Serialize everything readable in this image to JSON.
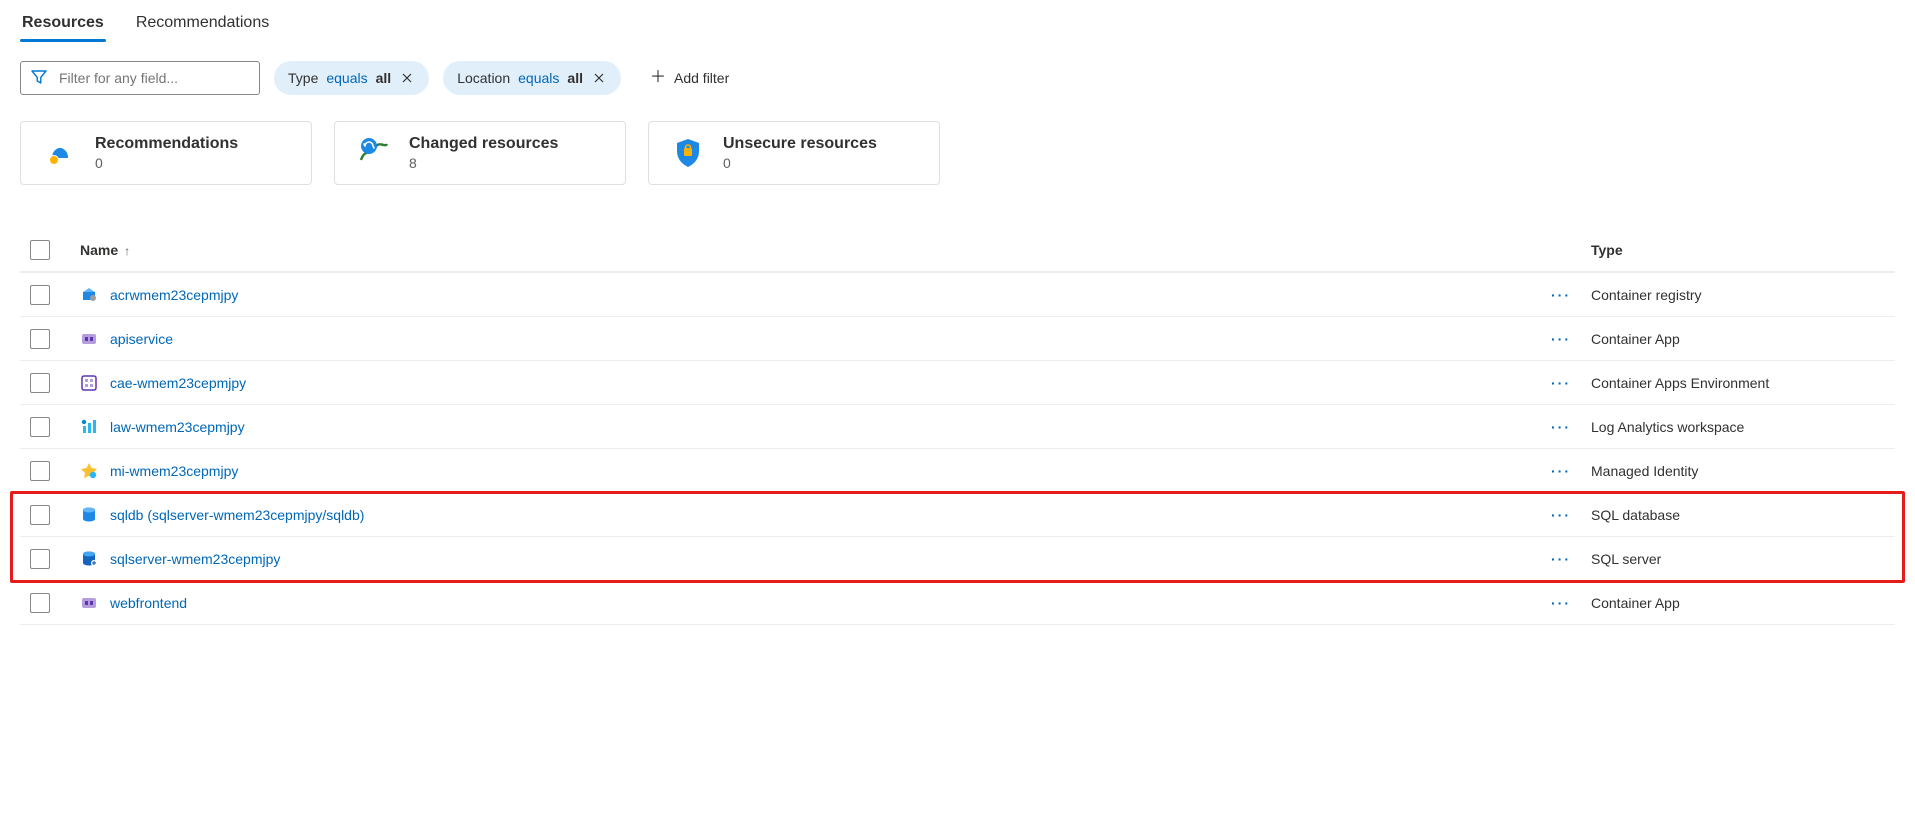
{
  "tabs": {
    "resources": "Resources",
    "recommendations": "Recommendations"
  },
  "filters": {
    "input_placeholder": "Filter for any field...",
    "chip1_field": "Type",
    "chip1_op": "equals",
    "chip1_val": "all",
    "chip2_field": "Location",
    "chip2_op": "equals",
    "chip2_val": "all",
    "add_label": "Add filter"
  },
  "cards": {
    "recs_title": "Recommendations",
    "recs_count": "0",
    "changed_title": "Changed resources",
    "changed_count": "8",
    "unsecure_title": "Unsecure resources",
    "unsecure_count": "0"
  },
  "table": {
    "col_name": "Name",
    "sort_arrow": "↑",
    "col_type": "Type",
    "rows": [
      {
        "name": "acrwmem23cepmjpy",
        "type": "Container registry",
        "icon": "registry"
      },
      {
        "name": "apiservice",
        "type": "Container App",
        "icon": "containerapp"
      },
      {
        "name": "cae-wmem23cepmjpy",
        "type": "Container Apps Environment",
        "icon": "cae"
      },
      {
        "name": "law-wmem23cepmjpy",
        "type": "Log Analytics workspace",
        "icon": "law"
      },
      {
        "name": "mi-wmem23cepmjpy",
        "type": "Managed Identity",
        "icon": "mi"
      },
      {
        "name": "sqldb (sqlserver-wmem23cepmjpy/sqldb)",
        "type": "SQL database",
        "icon": "sqldb"
      },
      {
        "name": "sqlserver-wmem23cepmjpy",
        "type": "SQL server",
        "icon": "sqlsrv"
      },
      {
        "name": "webfrontend",
        "type": "Container App",
        "icon": "containerapp"
      }
    ]
  },
  "highlight_rows": [
    5,
    6
  ]
}
